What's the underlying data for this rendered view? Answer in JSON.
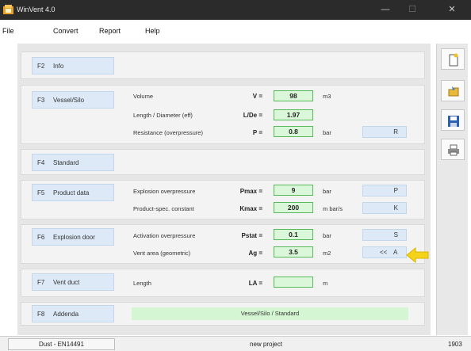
{
  "window": {
    "title": "WinVent 4.0",
    "minimize": "—",
    "maximize": "☐",
    "close": "✕"
  },
  "menu": {
    "file": "File",
    "convert": "Convert",
    "report": "Report",
    "help": "Help"
  },
  "sections": {
    "info": {
      "key": "F2",
      "label": "Info"
    },
    "vessel": {
      "key": "F3",
      "label": "Vessel/Silo",
      "volume": {
        "desc": "Volume",
        "sym": "V =",
        "value": "98",
        "unit": "m3"
      },
      "ld": {
        "desc": "Length / Diameter (eff)",
        "sym": "L/De =",
        "value": "1.97"
      },
      "resistance": {
        "desc": "Resistance (overpressure)",
        "sym": "P =",
        "value": "0.8",
        "unit": "bar",
        "button": "R"
      }
    },
    "standard": {
      "key": "F4",
      "label": "Standard"
    },
    "product": {
      "key": "F5",
      "label": "Product data",
      "pmax": {
        "desc": "Explosion overpressure",
        "sym": "Pmax =",
        "value": "9",
        "unit": "bar",
        "button": "P"
      },
      "kmax": {
        "desc": "Product-spec. constant",
        "sym": "Kmax =",
        "value": "200",
        "unit": "m bar/s",
        "button": "K"
      }
    },
    "door": {
      "key": "F6",
      "label": "Explosion door",
      "pstat": {
        "desc": "Activation overpressure",
        "sym": "Pstat =",
        "value": "0.1",
        "unit": "bar",
        "button": "S"
      },
      "ag": {
        "desc": "Vent area  (geometric)",
        "sym": "Ag =",
        "value": "3.5",
        "unit": "m2",
        "button_prefix": "<<",
        "button": "A"
      }
    },
    "duct": {
      "key": "F7",
      "label": "Vent duct",
      "la": {
        "desc": "Length",
        "sym": "LA =",
        "value": "",
        "unit": "m"
      }
    },
    "addenda": {
      "key": "F8",
      "label": "Addenda",
      "bar": "Vessel/Silo / Standard"
    }
  },
  "sidebar_icons": [
    "new-document-icon",
    "open-folder-icon",
    "save-icon",
    "print-icon"
  ],
  "status": {
    "left": "Dust - EN14491",
    "middle": "new project",
    "right": "1903"
  },
  "colors": {
    "value_bg": "#dbf7d9",
    "value_border": "#58b95a",
    "button_bg": "#dde9f7",
    "arrow": "#f5d31a"
  }
}
